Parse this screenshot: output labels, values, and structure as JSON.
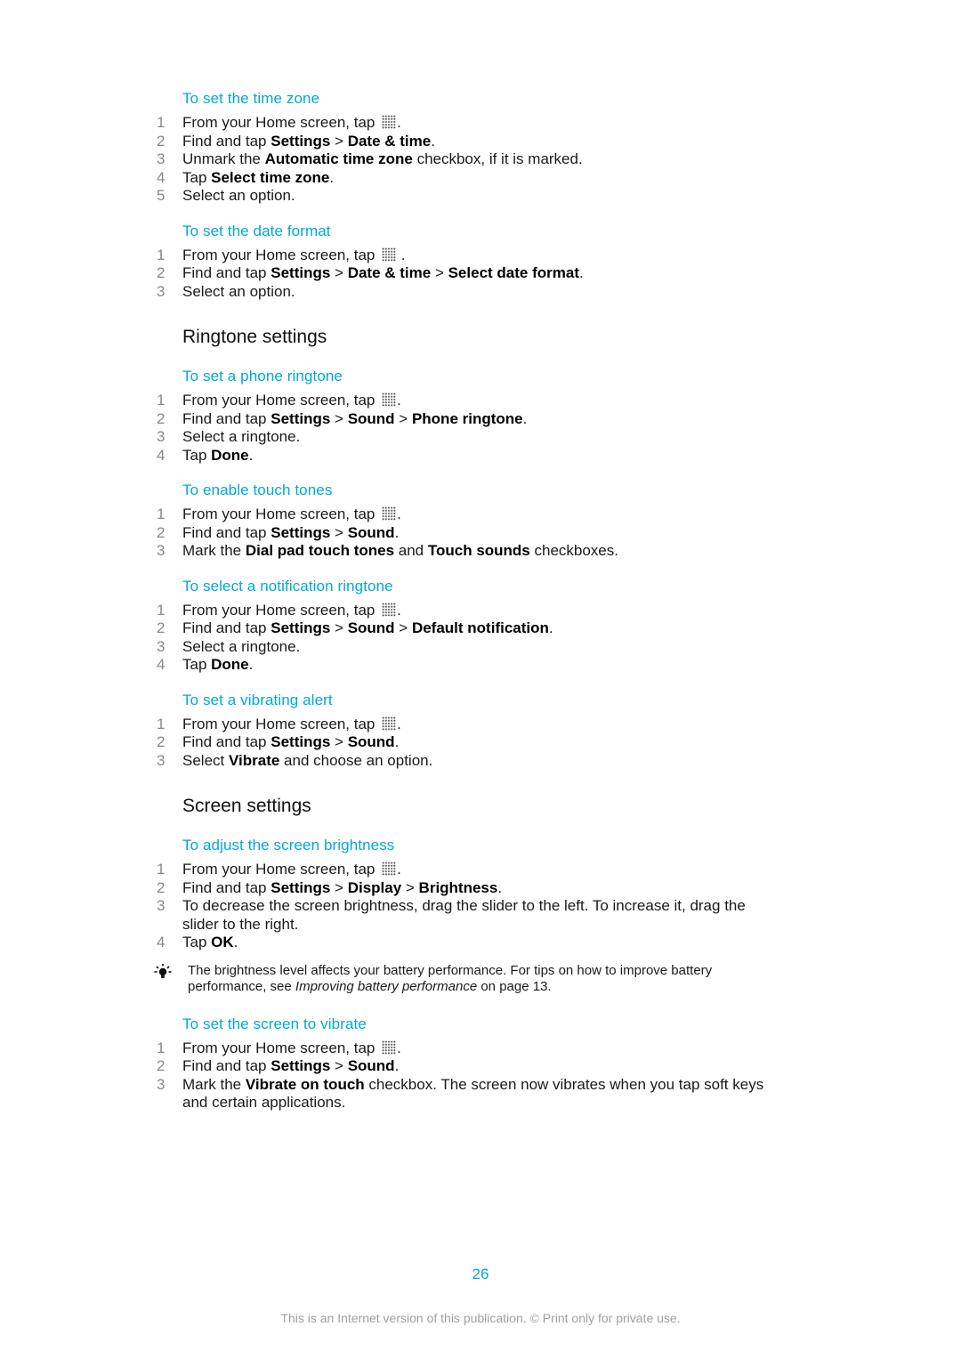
{
  "procedures_top": [
    {
      "title": "To set the time zone",
      "steps": [
        {
          "num": "1",
          "parts": [
            {
              "t": "From your Home screen, tap "
            },
            {
              "icon": "apps"
            },
            {
              "t": "."
            }
          ]
        },
        {
          "num": "2",
          "parts": [
            {
              "t": "Find and tap "
            },
            {
              "b": "Settings"
            },
            {
              "t": " > "
            },
            {
              "b": "Date & time"
            },
            {
              "t": "."
            }
          ]
        },
        {
          "num": "3",
          "parts": [
            {
              "t": "Unmark the "
            },
            {
              "b": "Automatic time zone"
            },
            {
              "t": " checkbox, if it is marked."
            }
          ]
        },
        {
          "num": "4",
          "parts": [
            {
              "t": "Tap "
            },
            {
              "b": "Select time zone"
            },
            {
              "t": "."
            }
          ]
        },
        {
          "num": "5",
          "parts": [
            {
              "t": "Select an option."
            }
          ]
        }
      ]
    },
    {
      "title": "To set the date format",
      "steps": [
        {
          "num": "1",
          "parts": [
            {
              "t": "From your Home screen, tap "
            },
            {
              "icon": "apps"
            },
            {
              "t": " ."
            }
          ]
        },
        {
          "num": "2",
          "parts": [
            {
              "t": "Find and tap "
            },
            {
              "b": "Settings"
            },
            {
              "t": " > "
            },
            {
              "b": "Date & time"
            },
            {
              "t": " > "
            },
            {
              "b": "Select date format"
            },
            {
              "t": "."
            }
          ]
        },
        {
          "num": "3",
          "parts": [
            {
              "t": "Select an option."
            }
          ]
        }
      ]
    }
  ],
  "sections": [
    {
      "title": "Ringtone settings",
      "procedures": [
        {
          "title": "To set a phone ringtone",
          "steps": [
            {
              "num": "1",
              "parts": [
                {
                  "t": "From your Home screen, tap "
                },
                {
                  "icon": "apps"
                },
                {
                  "t": "."
                }
              ]
            },
            {
              "num": "2",
              "parts": [
                {
                  "t": "Find and tap "
                },
                {
                  "b": "Settings"
                },
                {
                  "t": " > "
                },
                {
                  "b": "Sound"
                },
                {
                  "t": " > "
                },
                {
                  "b": "Phone ringtone"
                },
                {
                  "t": "."
                }
              ]
            },
            {
              "num": "3",
              "parts": [
                {
                  "t": "Select a ringtone."
                }
              ]
            },
            {
              "num": "4",
              "parts": [
                {
                  "t": "Tap "
                },
                {
                  "b": "Done"
                },
                {
                  "t": "."
                }
              ]
            }
          ]
        },
        {
          "title": "To enable touch tones",
          "steps": [
            {
              "num": "1",
              "parts": [
                {
                  "t": "From your Home screen, tap "
                },
                {
                  "icon": "apps"
                },
                {
                  "t": "."
                }
              ]
            },
            {
              "num": "2",
              "parts": [
                {
                  "t": "Find and tap "
                },
                {
                  "b": "Settings"
                },
                {
                  "t": " > "
                },
                {
                  "b": "Sound"
                },
                {
                  "t": "."
                }
              ]
            },
            {
              "num": "3",
              "parts": [
                {
                  "t": "Mark the "
                },
                {
                  "b": "Dial pad touch tones"
                },
                {
                  "t": " and "
                },
                {
                  "b": "Touch sounds"
                },
                {
                  "t": " checkboxes."
                }
              ]
            }
          ]
        },
        {
          "title": "To select a notification ringtone",
          "steps": [
            {
              "num": "1",
              "parts": [
                {
                  "t": "From your Home screen, tap "
                },
                {
                  "icon": "apps"
                },
                {
                  "t": "."
                }
              ]
            },
            {
              "num": "2",
              "parts": [
                {
                  "t": "Find and tap "
                },
                {
                  "b": "Settings"
                },
                {
                  "t": " > "
                },
                {
                  "b": "Sound"
                },
                {
                  "t": " > "
                },
                {
                  "b": "Default notification"
                },
                {
                  "t": "."
                }
              ]
            },
            {
              "num": "3",
              "parts": [
                {
                  "t": "Select a ringtone."
                }
              ]
            },
            {
              "num": "4",
              "parts": [
                {
                  "t": "Tap "
                },
                {
                  "b": "Done"
                },
                {
                  "t": "."
                }
              ]
            }
          ]
        },
        {
          "title": "To set a vibrating alert",
          "steps": [
            {
              "num": "1",
              "parts": [
                {
                  "t": "From your Home screen, tap "
                },
                {
                  "icon": "apps"
                },
                {
                  "t": "."
                }
              ]
            },
            {
              "num": "2",
              "parts": [
                {
                  "t": "Find and tap "
                },
                {
                  "b": "Settings"
                },
                {
                  "t": " > "
                },
                {
                  "b": "Sound"
                },
                {
                  "t": "."
                }
              ]
            },
            {
              "num": "3",
              "parts": [
                {
                  "t": "Select "
                },
                {
                  "b": "Vibrate"
                },
                {
                  "t": " and choose an option."
                }
              ]
            }
          ]
        }
      ]
    },
    {
      "title": "Screen settings",
      "procedures": [
        {
          "title": "To adjust the screen brightness",
          "steps": [
            {
              "num": "1",
              "parts": [
                {
                  "t": "From your Home screen, tap "
                },
                {
                  "icon": "apps"
                },
                {
                  "t": "."
                }
              ]
            },
            {
              "num": "2",
              "parts": [
                {
                  "t": "Find and tap "
                },
                {
                  "b": "Settings"
                },
                {
                  "t": " > "
                },
                {
                  "b": "Display"
                },
                {
                  "t": " > "
                },
                {
                  "b": "Brightness"
                },
                {
                  "t": "."
                }
              ]
            },
            {
              "num": "3",
              "parts": [
                {
                  "t": "To decrease the screen brightness, drag the slider to the left. To increase it, drag the slider to the right."
                }
              ]
            },
            {
              "num": "4",
              "parts": [
                {
                  "t": "Tap "
                },
                {
                  "b": "OK"
                },
                {
                  "t": "."
                }
              ]
            }
          ],
          "note": {
            "icon": "lightbulb-tip",
            "parts": [
              {
                "t": "The brightness level affects your battery performance. For tips on how to improve battery performance, see "
              },
              {
                "i": "Improving battery performance"
              },
              {
                "t": " on page 13."
              }
            ]
          }
        },
        {
          "title": "To set the screen to vibrate",
          "steps": [
            {
              "num": "1",
              "parts": [
                {
                  "t": "From your Home screen, tap "
                },
                {
                  "icon": "apps"
                },
                {
                  "t": "."
                }
              ]
            },
            {
              "num": "2",
              "parts": [
                {
                  "t": "Find and tap "
                },
                {
                  "b": "Settings"
                },
                {
                  "t": " > "
                },
                {
                  "b": "Sound"
                },
                {
                  "t": "."
                }
              ]
            },
            {
              "num": "3",
              "parts": [
                {
                  "t": "Mark the "
                },
                {
                  "b": "Vibrate on touch"
                },
                {
                  "t": " checkbox. The screen now vibrates when you tap soft keys and certain applications."
                }
              ]
            }
          ]
        }
      ]
    }
  ],
  "page_number": "26",
  "footer": "This is an Internet version of this publication. © Print only for private use.",
  "colors": {
    "heading_accent": "#00a9d6",
    "body_text": "#1a1a1a",
    "step_number": "#888888",
    "footer_text": "#a0a0a0"
  }
}
